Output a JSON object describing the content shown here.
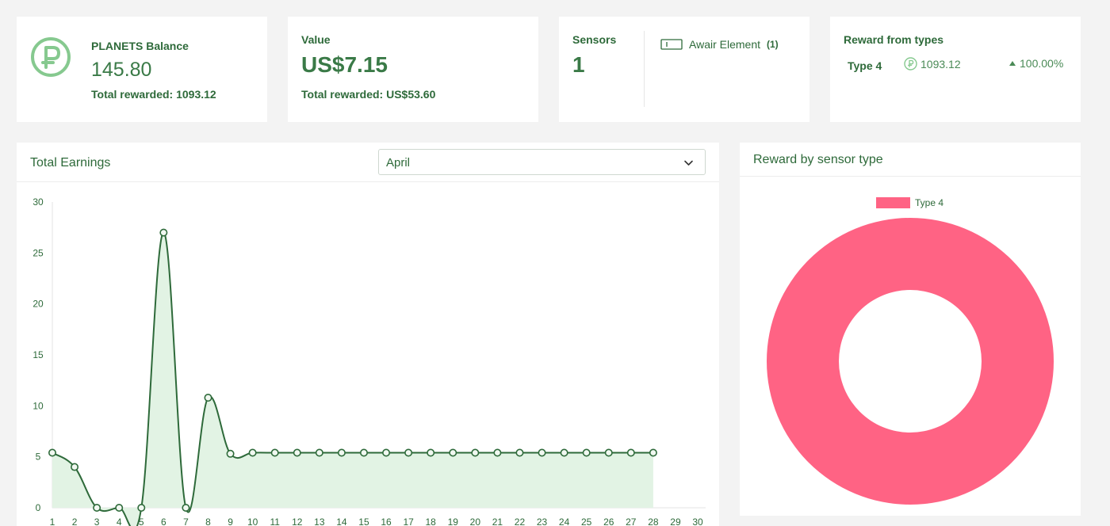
{
  "balance": {
    "title": "PLANETS Balance",
    "amount": "145.80",
    "total": "Total rewarded: 1093.12"
  },
  "value": {
    "title": "Value",
    "amount": "US$7.15",
    "total": "Total rewarded: US$53.60"
  },
  "sensors": {
    "title": "Sensors",
    "count": "1",
    "device_label": "Awair Element",
    "device_count": "(1)"
  },
  "reward_types": {
    "title": "Reward from types",
    "type": "Type 4",
    "amount": "1093.12",
    "percent": "100.00%"
  },
  "earnings": {
    "title": "Total Earnings",
    "month": "April"
  },
  "reward_sensor": {
    "title": "Reward by sensor type"
  },
  "colors": {
    "accent_green": "#2e6a3a",
    "fill_green": "#e2f3e4",
    "pie_pink": "#ff6384"
  },
  "chart_data": [
    {
      "type": "area",
      "x": [
        "1",
        "2",
        "3",
        "4",
        "5",
        "6",
        "7",
        "8",
        "9",
        "10",
        "11",
        "12",
        "13",
        "14",
        "15",
        "16",
        "17",
        "18",
        "19",
        "20",
        "21",
        "22",
        "23",
        "24",
        "25",
        "26",
        "27",
        "28",
        "29",
        "30"
      ],
      "values": [
        5.4,
        4.0,
        0,
        0,
        0,
        27.0,
        0,
        10.8,
        5.3,
        5.4,
        5.4,
        5.4,
        5.4,
        5.4,
        5.4,
        5.4,
        5.4,
        5.4,
        5.4,
        5.4,
        5.4,
        5.4,
        5.4,
        5.4,
        5.4,
        5.4,
        5.4,
        5.4
      ],
      "yticks": [
        "0",
        "5",
        "10",
        "15",
        "20",
        "25",
        "30"
      ],
      "ylim": [
        0,
        30
      ],
      "grid": false
    },
    {
      "type": "pie",
      "legend": [
        "Type 4"
      ],
      "legend_position": "top",
      "values": [
        1093.12
      ],
      "donut": true
    }
  ]
}
